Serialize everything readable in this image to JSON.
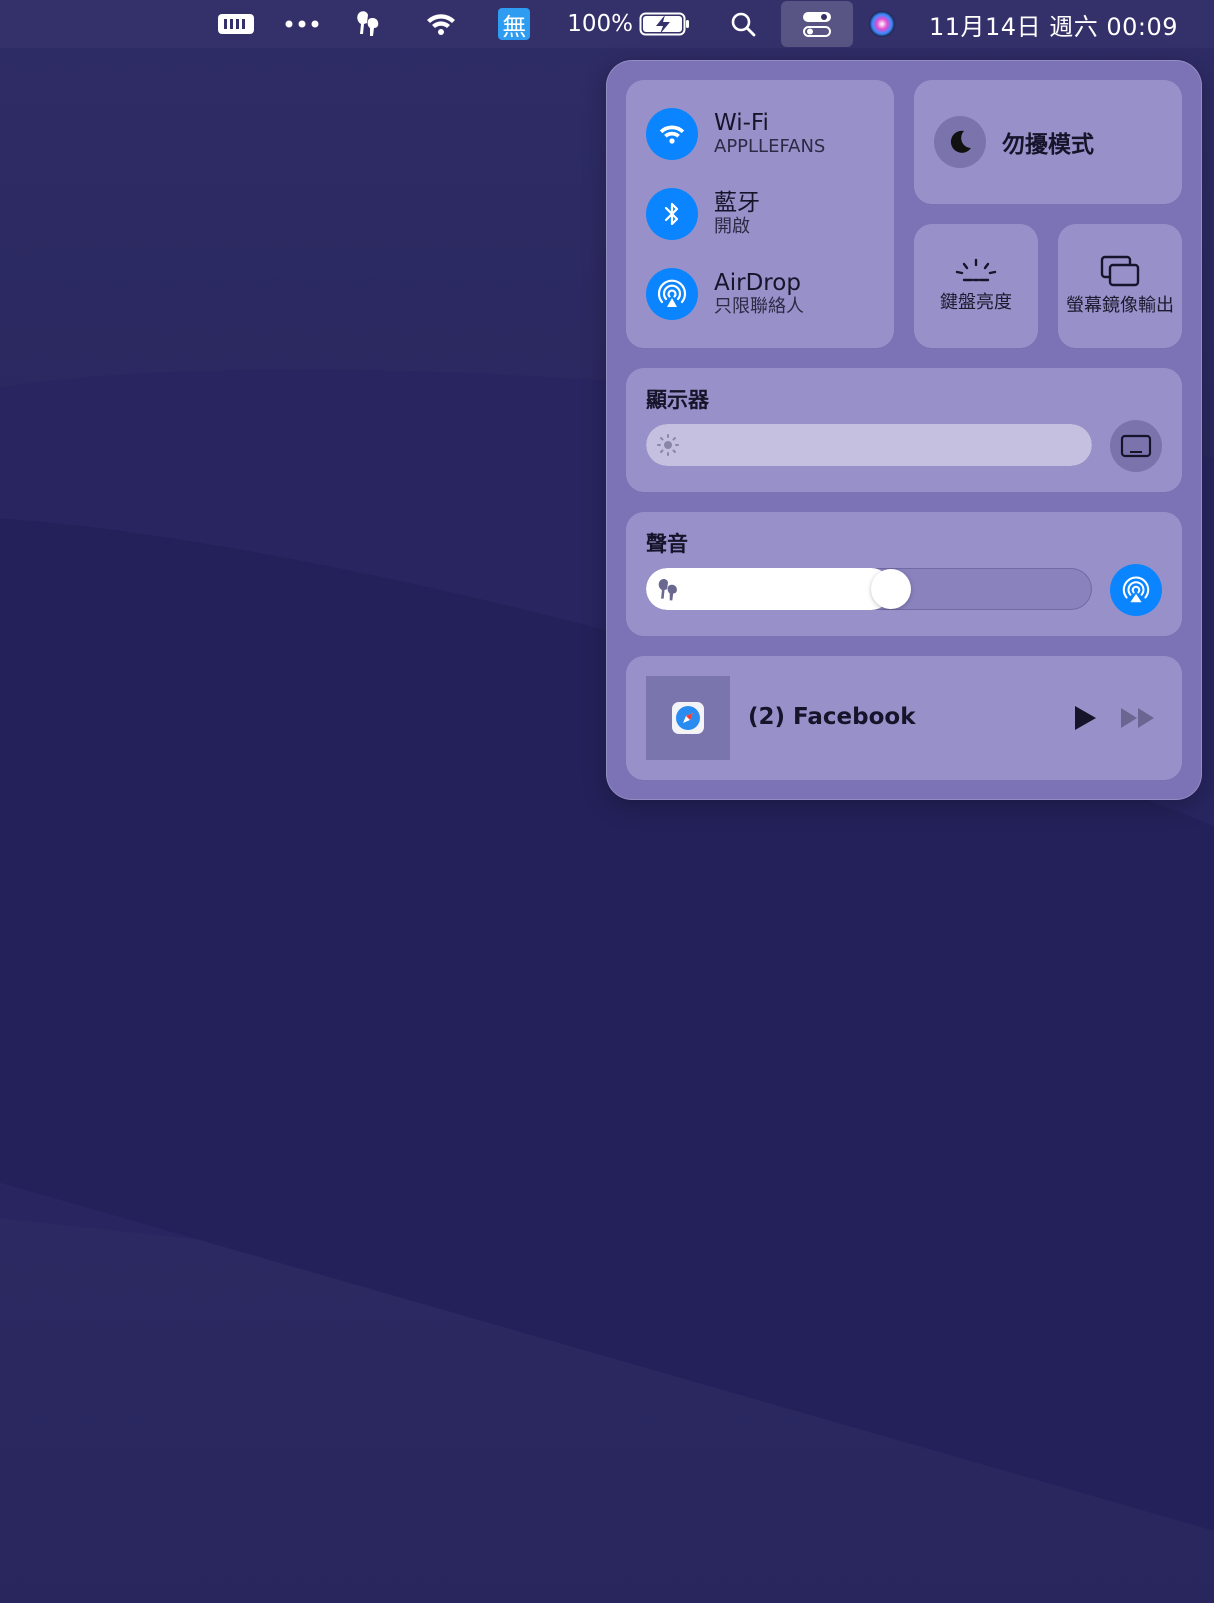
{
  "menubar": {
    "battery_percent": "100%",
    "clock": "11月14日 週六  00:09",
    "icons": [
      "memory-icon",
      "more-icon",
      "airpods-icon",
      "wifi-icon",
      "input-method-icon",
      "battery-icon",
      "search-icon",
      "control-center-icon",
      "siri-icon"
    ],
    "input_method_label": "無"
  },
  "control_center": {
    "connectivity": {
      "wifi": {
        "title": "Wi-Fi",
        "subtitle": "APPLLEFANS"
      },
      "bluetooth": {
        "title": "藍牙",
        "subtitle": "開啟"
      },
      "airdrop": {
        "title": "AirDrop",
        "subtitle": "只限聯絡人"
      }
    },
    "dnd": {
      "label": "勿擾模式"
    },
    "keyboard_brightness": {
      "label": "鍵盤亮度"
    },
    "screen_mirroring": {
      "label": "螢幕鏡像輸出"
    },
    "display": {
      "title": "顯示器",
      "brightness_fraction": 1.0
    },
    "sound": {
      "title": "聲音",
      "volume_fraction": 0.55
    },
    "now_playing": {
      "title": "(2) Facebook"
    },
    "colors": {
      "accent": "#0a84ff",
      "tile": "#9891c9",
      "panel": "#7b73b6"
    }
  }
}
